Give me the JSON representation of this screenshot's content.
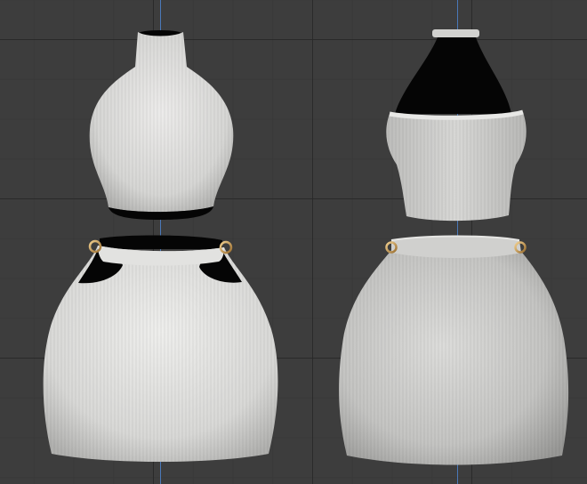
{
  "viewport": {
    "name": "3D viewport",
    "background_color": "#3d3d3d",
    "grid_color": "#2a2a2a",
    "axis_color": "#4a78b8"
  },
  "objects": [
    {
      "id": "halter-top-front",
      "label": ""
    },
    {
      "id": "halter-top-back",
      "label": ""
    },
    {
      "id": "skirt-front",
      "label": ""
    },
    {
      "id": "skirt-back",
      "label": ""
    }
  ],
  "colors": {
    "knit_light": "#e6e6e4",
    "knit_mid": "#c8c8c6",
    "knit_shadow": "#9a9a98",
    "interior_black": "#050505",
    "ring_gold": "#c79a55"
  }
}
